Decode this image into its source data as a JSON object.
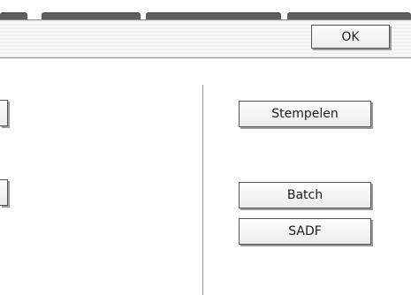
{
  "header": {
    "ok_label": "OK"
  },
  "buttons": {
    "stamp_label": "Stempelen",
    "batch_label": "Batch",
    "sadf_label": "SADF"
  }
}
